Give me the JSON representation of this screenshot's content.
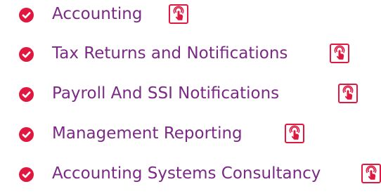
{
  "colors": {
    "accent": "#e0173f",
    "text": "#7a2a84"
  },
  "icons": {
    "bullet": "check-circle-icon",
    "link": "tap-finger-icon"
  },
  "services": [
    {
      "label": "Accounting"
    },
    {
      "label": "Tax Returns and Notifications"
    },
    {
      "label": "Payroll And SSI Notifications"
    },
    {
      "label": "Management Reporting"
    },
    {
      "label": "Accounting Systems Consultancy"
    }
  ]
}
